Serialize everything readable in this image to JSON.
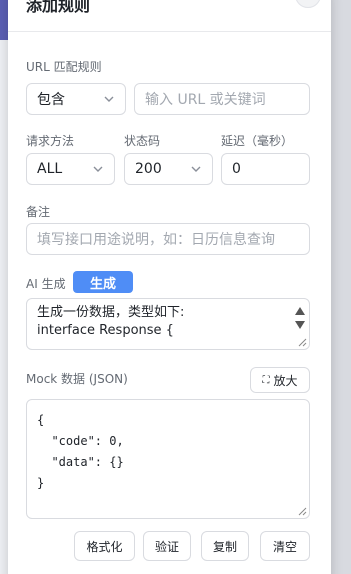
{
  "dialog": {
    "title": "添加规则",
    "close_icon": "close-icon"
  },
  "url_rule": {
    "label": "URL 匹配规则",
    "match_type": "包含",
    "placeholder": "输入 URL 或关键词"
  },
  "method": {
    "label": "请求方法",
    "value": "ALL"
  },
  "status": {
    "label": "状态码",
    "value": "200"
  },
  "delay": {
    "label": "延迟（毫秒）",
    "value": "0"
  },
  "note": {
    "label": "备注",
    "placeholder": "填写接口用途说明，如：日历信息查询"
  },
  "ai": {
    "label": "AI 生成",
    "generate_button": "生成",
    "prompt_line1": "生成一份数据，类型如下:",
    "prompt_line2": "interface Response {"
  },
  "mock": {
    "label": "Mock 数据 (JSON)",
    "zoom_button": "放大",
    "json_text": "{\n  \"code\": 0,\n  \"data\": {}\n}"
  },
  "actions": {
    "format": "格式化",
    "validate": "验证",
    "copy": "复制",
    "clear": "清空"
  },
  "colors": {
    "primary": "#4f8df6",
    "header_band": "#5b5fb4"
  }
}
